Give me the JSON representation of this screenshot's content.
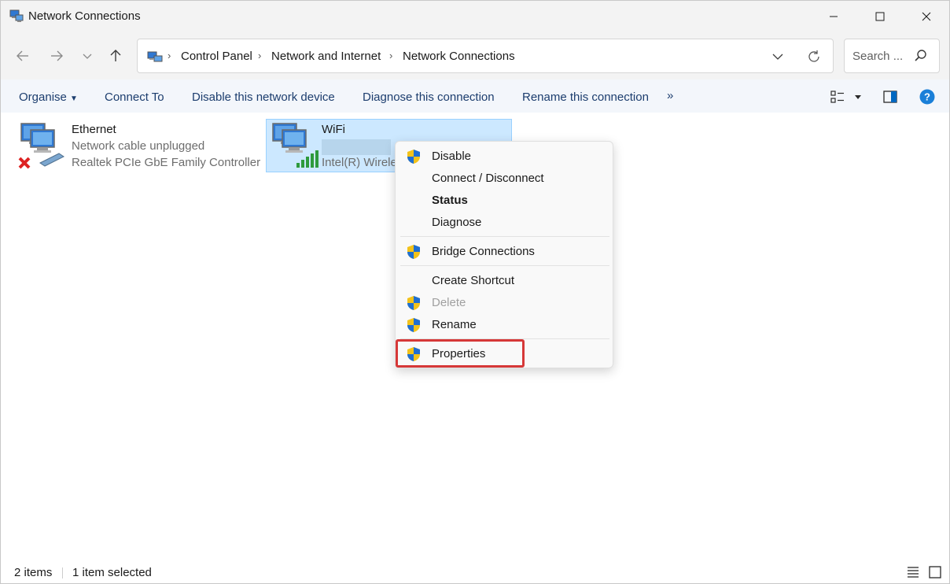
{
  "window": {
    "title": "Network Connections",
    "controls": [
      "minimize",
      "maximize",
      "close"
    ]
  },
  "address": {
    "breadcrumbs": [
      "Control Panel",
      "Network and Internet",
      "Network Connections"
    ],
    "search_placeholder": "Search ..."
  },
  "commands": {
    "organise": "Organise",
    "connect_to": "Connect To",
    "disable_device": "Disable this network device",
    "diagnose": "Diagnose this connection",
    "rename": "Rename this connection",
    "more": "»"
  },
  "connections": [
    {
      "name": "Ethernet",
      "status": "Network cable unplugged",
      "device": "Realtek PCIe GbE Family Controller",
      "icon": "network-adapter-disconnected-icon",
      "selected": false
    },
    {
      "name": "WiFi",
      "status": "",
      "device": "Intel(R) Wirele",
      "icon": "wifi-adapter-icon",
      "selected": true
    }
  ],
  "context_menu": {
    "items": [
      {
        "label": "Disable",
        "shield": true,
        "style": "normal"
      },
      {
        "label": "Connect / Disconnect",
        "shield": false,
        "style": "normal"
      },
      {
        "label": "Status",
        "shield": false,
        "style": "bold"
      },
      {
        "label": "Diagnose",
        "shield": false,
        "style": "normal"
      },
      {
        "label": "Bridge Connections",
        "shield": true,
        "style": "normal"
      },
      {
        "label": "Create Shortcut",
        "shield": false,
        "style": "normal"
      },
      {
        "label": "Delete",
        "shield": true,
        "style": "disabled"
      },
      {
        "label": "Rename",
        "shield": true,
        "style": "normal"
      },
      {
        "label": "Properties",
        "shield": true,
        "style": "normal",
        "highlighted": true
      }
    ]
  },
  "status": {
    "item_count": "2 items",
    "selection": "1 item selected"
  },
  "colors": {
    "accent": "#0067c0",
    "selection": "#cce8ff",
    "highlight_box": "#d63838",
    "command_text": "#1c3d6e"
  }
}
